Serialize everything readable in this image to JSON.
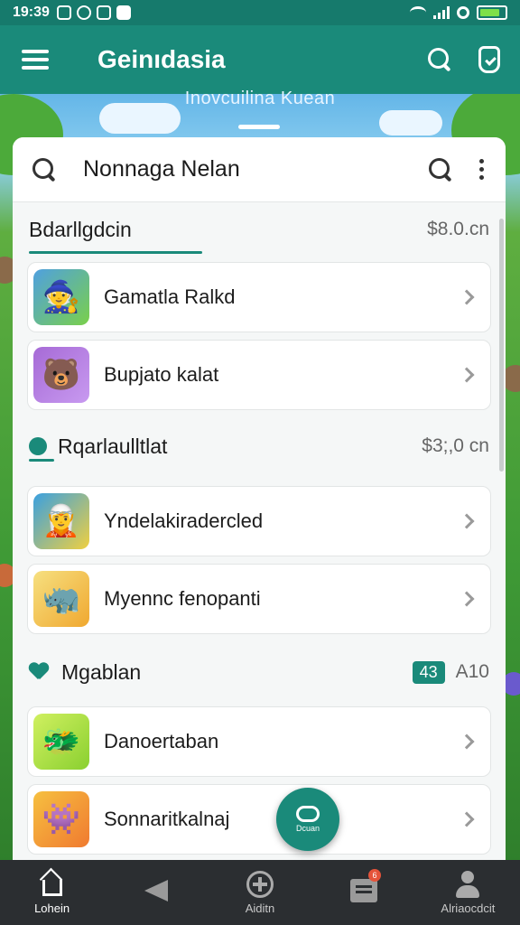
{
  "status_bar": {
    "time": "19:39"
  },
  "app_bar": {
    "title": "Geinıdasia"
  },
  "banner": "Inovcuilina Kuean",
  "search": {
    "query": "Nonnaga Nelan"
  },
  "sections": [
    {
      "title": "Bdarllgdcin",
      "value": "$8.0.cn",
      "items": [
        {
          "label": "Gamatla Ralkd",
          "icon": "adventurer-icon",
          "color": "#4fa0e0"
        },
        {
          "label": "Bupjato kalat",
          "icon": "bear-icon",
          "color": "#a66ad6"
        }
      ]
    },
    {
      "title": "Rqarlaulltlat",
      "value": "$3;,0 cn",
      "items": [
        {
          "label": "Yndelakiradercled",
          "icon": "witch-icon",
          "color": "#e8c53a"
        },
        {
          "label": "Myennc fenopanti",
          "icon": "rhino-icon",
          "color": "#f0b63a"
        }
      ]
    },
    {
      "title": "Mgablan",
      "badge": "43",
      "value": "A10",
      "items": [
        {
          "label": "Danoertaban",
          "icon": "dragon-icon",
          "color": "#b6e03a"
        },
        {
          "label": "Sonnaritkalnaj",
          "icon": "monster-icon",
          "color": "#f0a23a"
        }
      ]
    }
  ],
  "fab": {
    "label": "Dcuan"
  },
  "bottom_nav": [
    {
      "label": "Lohein",
      "icon": "home-icon",
      "active": true
    },
    {
      "label": "",
      "icon": "send-icon",
      "active": false
    },
    {
      "label": "Aiditn",
      "icon": "add-circle-icon",
      "active": false
    },
    {
      "label": "",
      "icon": "inbox-icon",
      "active": false,
      "badge": "6"
    },
    {
      "label": "Alriaocdcit",
      "icon": "profile-icon",
      "active": false
    }
  ],
  "colors": {
    "primary": "#1a8a7a",
    "status_bar": "#167a6c",
    "nav_bg": "#2b2e31"
  }
}
